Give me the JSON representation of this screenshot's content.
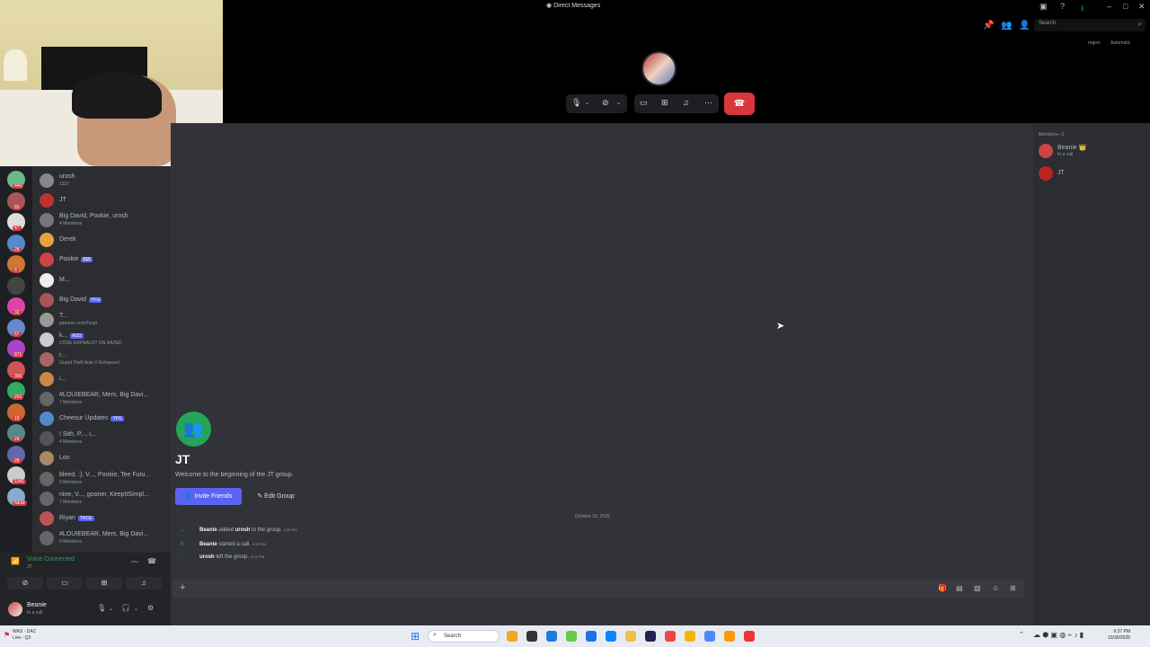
{
  "window": {
    "title": "Direct Messages",
    "icons": [
      "inbox-icon",
      "help-icon",
      "download-icon",
      "minimize-icon",
      "maximize-icon",
      "close-icon"
    ]
  },
  "header": {
    "search_placeholder": "Search",
    "region_label": "region",
    "region_value": "Automatic"
  },
  "call_controls": {
    "buttons": [
      "microphone-icon",
      "camera-off-icon",
      "screen-share-icon",
      "activities-icon",
      "soundboard-icon",
      "more-icon"
    ],
    "hangup": "hangup-icon"
  },
  "servers": [
    {
      "color": "#6b8",
      "badge": "446"
    },
    {
      "color": "#a55",
      "badge": "83"
    },
    {
      "color": "#ddd",
      "badge": "47"
    },
    {
      "color": "#58c",
      "badge": "28"
    },
    {
      "color": "#c73",
      "badge": "8"
    },
    {
      "color": "#444",
      "badge": ""
    },
    {
      "color": "#d4a",
      "badge": "32"
    },
    {
      "color": "#68c",
      "badge": "67"
    },
    {
      "color": "#a4c",
      "badge": "871"
    },
    {
      "color": "#c55",
      "badge": "366"
    },
    {
      "color": "#3a6",
      "badge": "261"
    },
    {
      "color": "#c63",
      "badge": "18"
    },
    {
      "color": "#588",
      "badge": "24"
    },
    {
      "color": "#66a",
      "badge": "28"
    },
    {
      "color": "#ccc",
      "badge": "1341"
    },
    {
      "color": "#8ac",
      "badge": "NEW"
    }
  ],
  "dm_list": [
    {
      "name": "urosh",
      "sub": "1337",
      "tag": "",
      "color": "#888"
    },
    {
      "name": "JT",
      "sub": "",
      "tag": "",
      "color": "#b33"
    },
    {
      "name": "Big David, Pookie, urosh",
      "sub": "4 Members",
      "tag": "",
      "color": "#777"
    },
    {
      "name": "Derek",
      "sub": "",
      "tag": "",
      "color": "#e8a33a"
    },
    {
      "name": "Pookie",
      "sub": "",
      "tag": "$$$",
      "color": "#c44"
    },
    {
      "name": "M...",
      "sub": "",
      "tag": "",
      "color": "#eee"
    },
    {
      "name": "Big David",
      "sub": "",
      "tag": "YFG",
      "color": "#a55"
    },
    {
      "name": "T...",
      "sub": "paname.com/Tsopi",
      "tag": "",
      "color": "#999"
    },
    {
      "name": "k...",
      "sub": "CODE KAPNALOT ON RAZED",
      "tag": "RZD",
      "color": "#ccc"
    },
    {
      "name": "r...",
      "sub": "Grand Theft Auto V Enhanced",
      "tag": "",
      "color": "#a66"
    },
    {
      "name": "i...",
      "sub": "",
      "tag": "",
      "color": "#c84"
    },
    {
      "name": "#LOUIEBEAR, Mers, Big Davi...",
      "sub": "7 Members",
      "tag": "",
      "color": "#666"
    },
    {
      "name": "Cheesur Updates",
      "sub": "",
      "tag": "YFG",
      "color": "#58c"
    },
    {
      "name": "! Sith, P..., i...",
      "sub": "4 Members",
      "tag": "",
      "color": "#555"
    },
    {
      "name": "Lon",
      "sub": "",
      "tag": "",
      "color": "#a86"
    },
    {
      "name": "bleed, :), V..., Pookie, Tee Futu...",
      "sub": "9 Members",
      "tag": "",
      "color": "#666"
    },
    {
      "name": "nine, V..., gooner, KeepItSimpl...",
      "sub": "7 Members",
      "tag": "",
      "color": "#666"
    },
    {
      "name": "Riyan",
      "sub": "",
      "tag": "TRCE",
      "color": "#b55"
    },
    {
      "name": "#LOUIEBEAR, Mers, Big Davi...",
      "sub": "9 Members",
      "tag": "",
      "color": "#666"
    }
  ],
  "voice": {
    "status": "Voice Connected",
    "channel": "JT",
    "buttons": [
      "camera-icon",
      "screen-share-icon",
      "activities-icon",
      "soundboard-icon"
    ]
  },
  "user": {
    "name": "Beanie",
    "status": "In a call"
  },
  "chat": {
    "group_name": "JT",
    "welcome": "Welcome to the beginning of the JT group.",
    "invite_label": "Invite Friends",
    "edit_label": "Edit Group",
    "date_divider": "October 30, 2025",
    "messages": [
      {
        "icon": "→",
        "actor": "Beanie",
        "text": " added ",
        "target": "urosh",
        "rest": " to the group.",
        "time": "9:30 PM",
        "color": "#23a55a"
      },
      {
        "icon": "✆",
        "actor": "Beanie",
        "text": " started a call.",
        "target": "",
        "rest": "",
        "time": "9:30 PM",
        "color": "#23a55a"
      },
      {
        "icon": "←",
        "actor": "urosh",
        "text": " left the group.",
        "target": "",
        "rest": "",
        "time": "9:31 PM",
        "color": "#da373c"
      }
    ]
  },
  "members": {
    "heading": "Members—2",
    "list": [
      {
        "name": "Beanie 👑",
        "status": "In a call",
        "color": "#c44"
      },
      {
        "name": "JT",
        "status": "",
        "color": "#b22"
      }
    ]
  },
  "taskbar": {
    "weather_line1": "WAS - DAC",
    "weather_line2": "Live - Q3",
    "search": "Search",
    "time": "9:37 PM",
    "date": "10/30/2025",
    "apps": [
      "#f5a623",
      "#333",
      "#1f7ae0",
      "#6c4",
      "#1a73e8",
      "#0a84ff",
      "#f0c040",
      "#225",
      "#e44",
      "#f4b400",
      "#4a8cf7",
      "#f90",
      "#e33"
    ]
  }
}
